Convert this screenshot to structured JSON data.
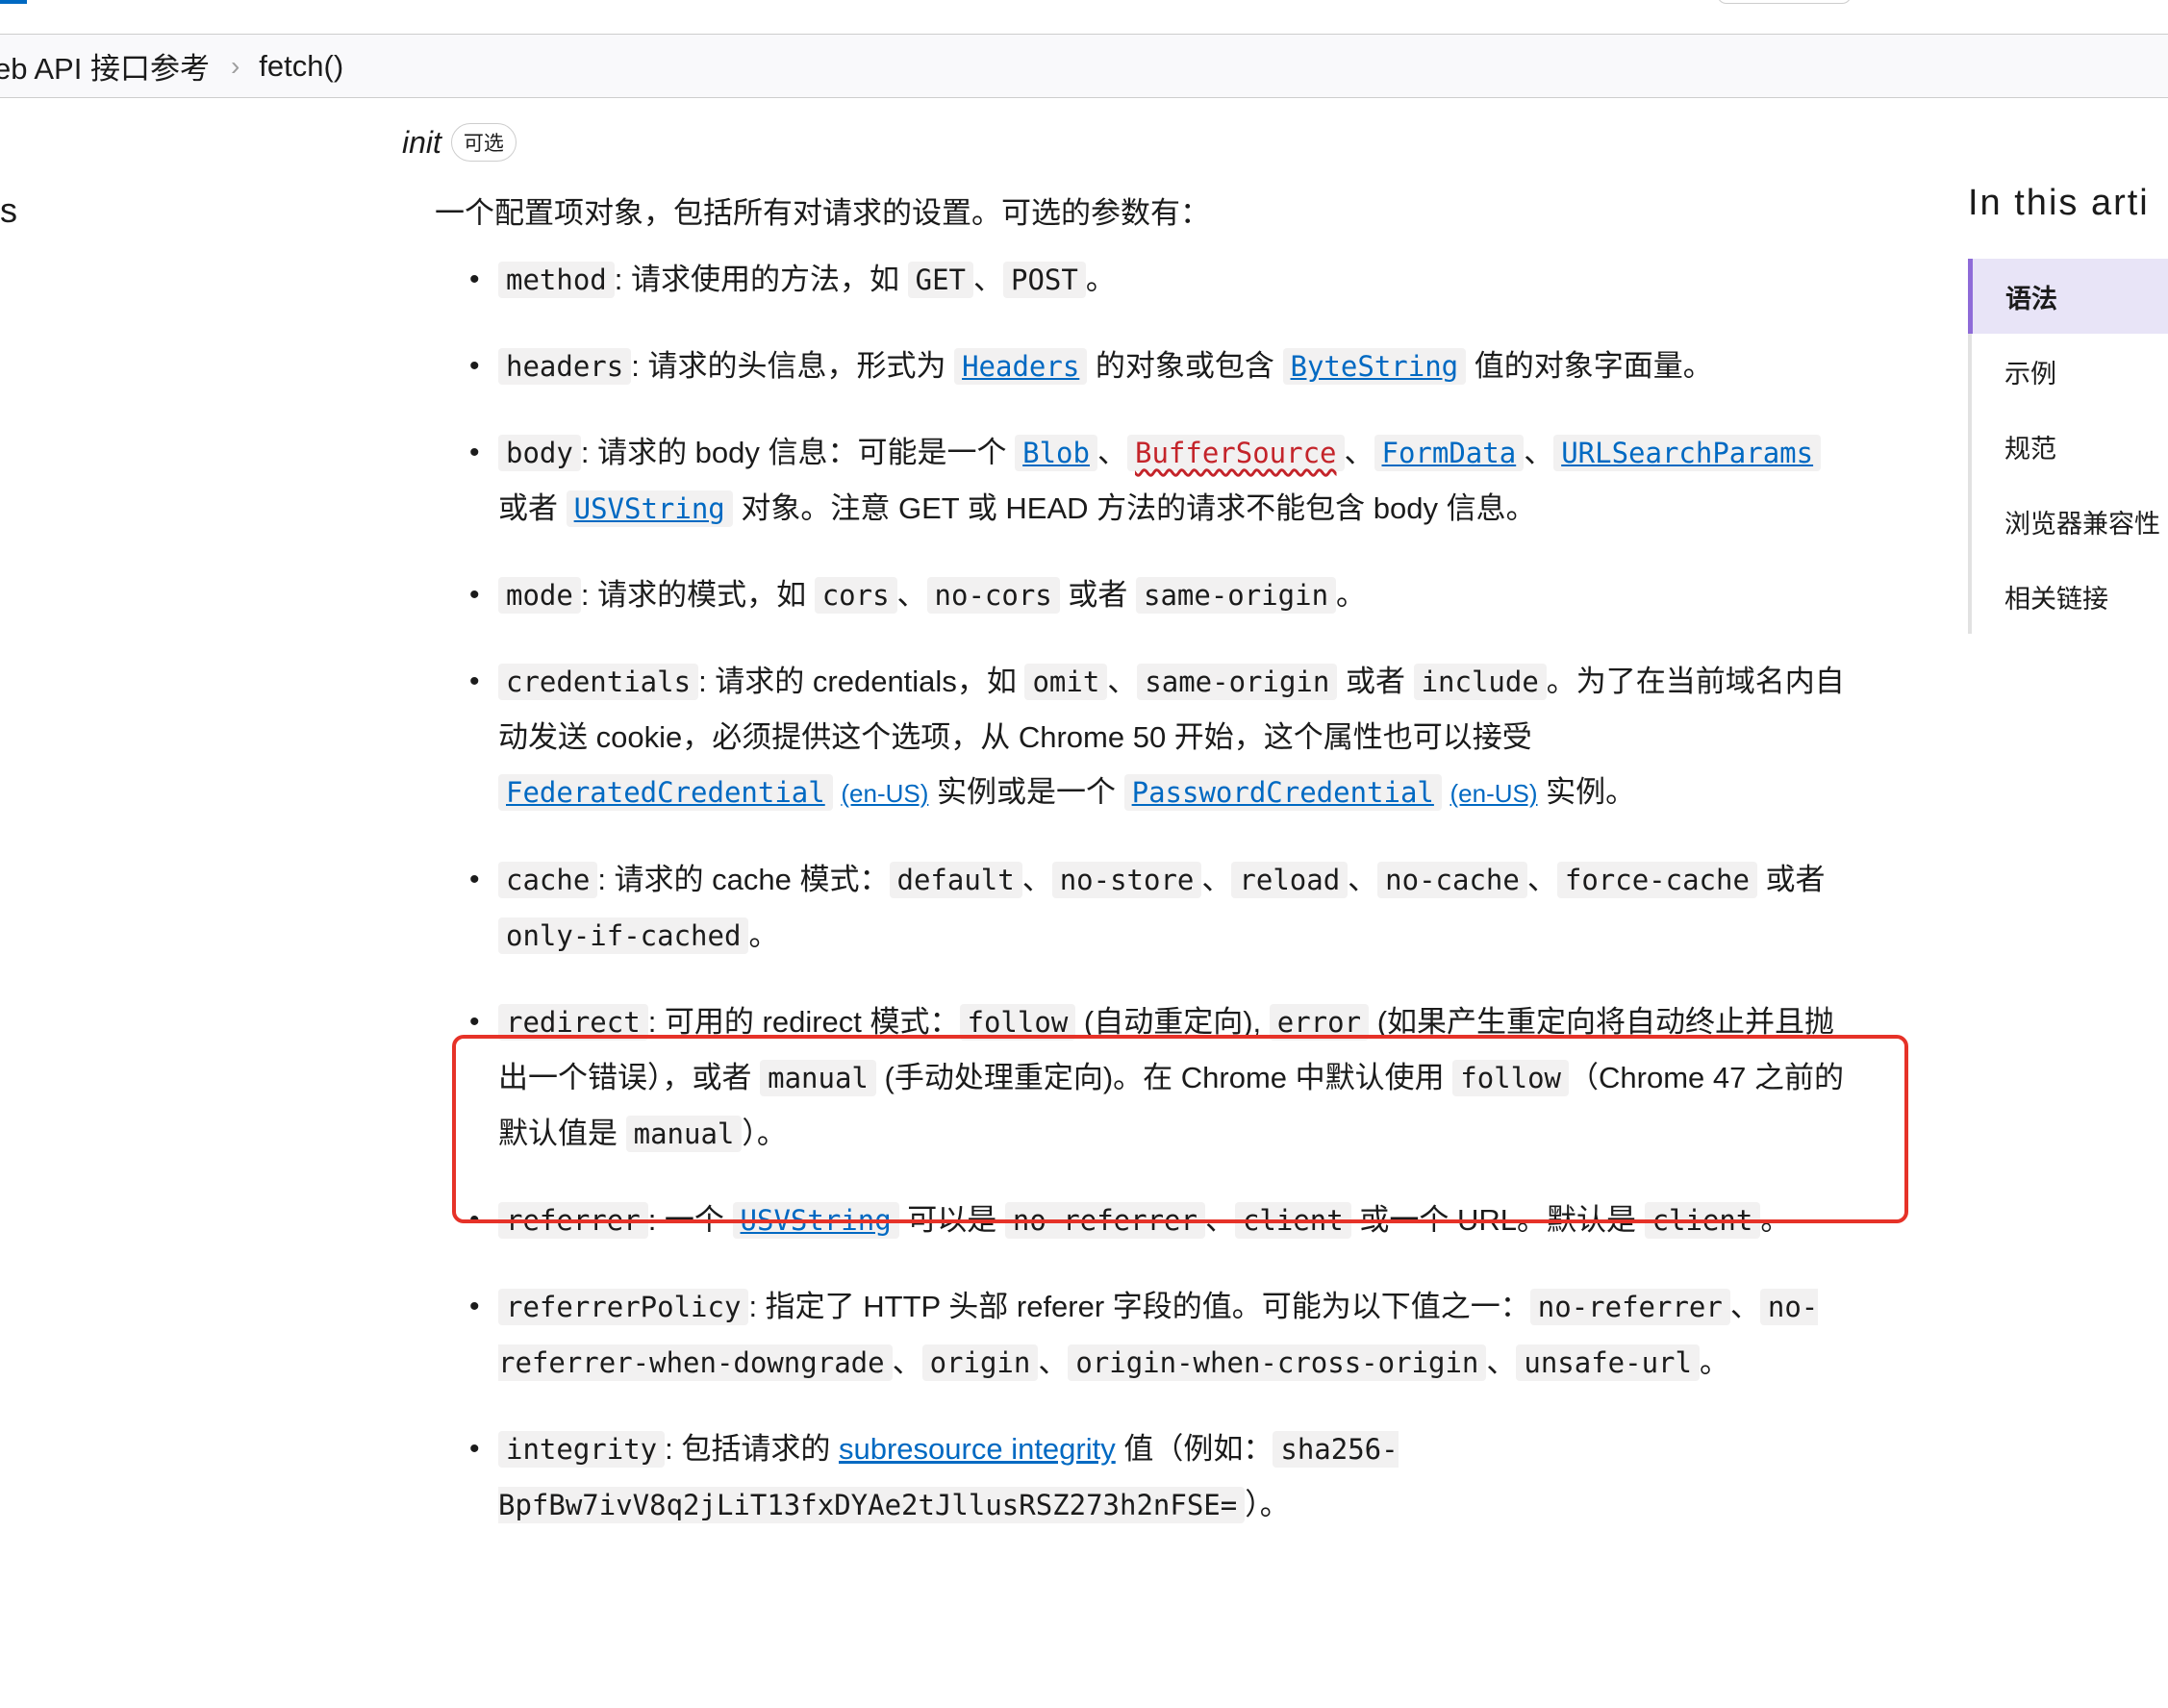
{
  "breadcrumb": {
    "parent": "eb API 接口参考",
    "separator": "›",
    "current": "fetch()"
  },
  "left_cut_text": "s",
  "param": {
    "name": "init",
    "badge": "可选",
    "description": "一个配置项对象，包括所有对请求的设置。可选的参数有："
  },
  "options": {
    "method": {
      "key": "method",
      "t1": ": 请求使用的方法，如 ",
      "c1": "GET",
      "t2": "、",
      "c2": "POST",
      "t3": "。"
    },
    "headers": {
      "key": "headers",
      "t1": ": 请求的头信息，形式为 ",
      "l1": "Headers",
      "t2": " 的对象或包含 ",
      "l2": "ByteString",
      "t3": " 值的对象字面量。"
    },
    "body": {
      "key": "body",
      "t1": ": 请求的 body 信息：可能是一个 ",
      "l1": "Blob",
      "t2": "、",
      "l2": "BufferSource",
      "t3": "、",
      "l3": "FormData",
      "t4": "、",
      "l4": "URLSearchParams",
      "t5": " 或者 ",
      "l5": "USVString",
      "t6": " 对象。注意 GET 或 HEAD 方法的请求不能包含 body 信息。"
    },
    "mode": {
      "key": "mode",
      "t1": ": 请求的模式，如 ",
      "c1": "cors",
      "t2": "、",
      "c2": "no-cors",
      "t3": " 或者 ",
      "c3": "same-origin",
      "t4": "。"
    },
    "credentials": {
      "key": "credentials",
      "t1": ": 请求的 credentials，如 ",
      "c1": "omit",
      "t2": "、",
      "c2": "same-origin",
      "t3": " 或者 ",
      "c3": "include",
      "t4": "。为了在当前域名内自动发送 cookie，必须提供这个选项，从 Chrome 50 开始，这个属性也可以接受 ",
      "l1": "FederatedCredential",
      "e1": "(en-US)",
      "t5": " 实例或是一个 ",
      "l2": "PasswordCredential",
      "e2": "(en-US)",
      "t6": " 实例。"
    },
    "cache": {
      "key": "cache",
      "t1": ": 请求的 cache 模式：",
      "c1": "default",
      "t2": "、",
      "c2": "no-store",
      "t3": "、",
      "c3": "reload",
      "t4": "、",
      "c4": "no-cache",
      "t5": "、",
      "c5": "force-cache",
      "t6": " 或者 ",
      "c6": "only-if-cached",
      "t7": "。"
    },
    "redirect": {
      "key": "redirect",
      "t1": ": 可用的 redirect 模式：",
      "c1": "follow",
      "t2": " (自动重定向), ",
      "c2": "error",
      "t3": " (如果产生重定向将自动终止并且抛出一个错误），或者 ",
      "c3": "manual",
      "t4": " (手动处理重定向)。在 Chrome 中默认使用 ",
      "c4": "follow",
      "t5": "（Chrome 47 之前的默认值是 ",
      "c5": "manual",
      "t6": "）。"
    },
    "referrer": {
      "key": "referrer",
      "t1": ": 一个 ",
      "l1": "USVString",
      "t2": " 可以是 ",
      "c1": "no-referrer",
      "t3": "、",
      "c2": "client",
      "t4": " 或一个 URL。默认是 ",
      "c3": "client",
      "t5": "。"
    },
    "referrerPolicy": {
      "key": "referrerPolicy",
      "t1": ": 指定了 HTTP 头部 referer 字段的值。可能为以下值之一：",
      "c1": "no-referrer",
      "t2": "、",
      "c2": "no-referrer-when-downgrade",
      "t3": "、",
      "c3": "origin",
      "t4": "、",
      "c4": "origin-when-cross-origin",
      "t5": "、",
      "c5": "unsafe-url",
      "t6": "。"
    },
    "integrity": {
      "key": "integrity",
      "t1": ": 包括请求的 ",
      "l1": "subresource integrity",
      "t2": " 值（例如：",
      "c1": "sha256-BpfBw7ivV8q2jLiT13fxDYAe2tJllusRSZ273h2nFSE=",
      "t3": "）。"
    }
  },
  "toc": {
    "title": "In this arti",
    "items": [
      "语法",
      "示例",
      "规范",
      "浏览器兼容性",
      "相关链接"
    ],
    "active_index": 0
  },
  "colors": {
    "link": "#0069c2",
    "broken_link": "#c4242a",
    "highlight_border": "#e63228",
    "toc_active_bg": "#e8e4f7",
    "toc_active_bar": "#8e6bd8"
  }
}
